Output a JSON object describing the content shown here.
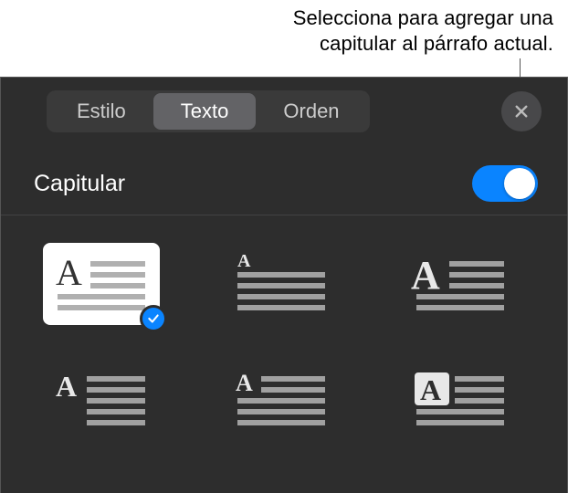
{
  "callout": {
    "line1": "Selecciona para agregar una",
    "line2": "capitular al párrafo actual."
  },
  "tabs": {
    "style": "Estilo",
    "text": "Texto",
    "order": "Orden",
    "active": "text"
  },
  "section": {
    "title": "Capitular",
    "toggle_on": true
  },
  "dropcap_styles": {
    "selected_index": 0,
    "items": [
      {
        "name": "dropcap-2line-standard"
      },
      {
        "name": "dropcap-raised-small"
      },
      {
        "name": "dropcap-large-left"
      },
      {
        "name": "dropcap-3line-left"
      },
      {
        "name": "dropcap-4line-left"
      },
      {
        "name": "dropcap-boxed-reverse"
      }
    ]
  },
  "icons": {
    "close": "close",
    "check": "check"
  },
  "colors": {
    "accent": "#0a84ff",
    "panel_bg": "#2d2d2d",
    "line": "#a0a0a0"
  }
}
